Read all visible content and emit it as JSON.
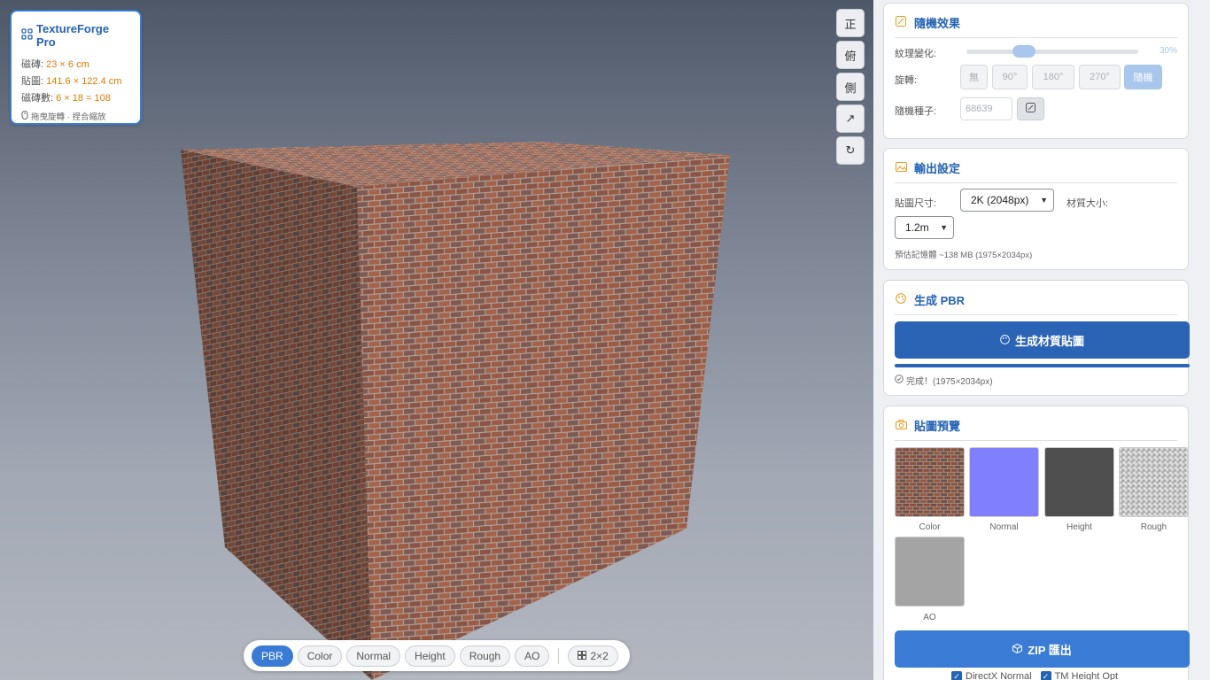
{
  "app": {
    "title": "TextureForge Pro",
    "tile_label": "磁磚: ",
    "tile_value": "23 × 6 cm",
    "map_label": "貼圖: ",
    "map_value": "141.6 × 122.4 cm",
    "count_label": "磁磚數: ",
    "count_value": "6 × 18 = 108",
    "hint": "拖曳旋轉 · 捏合縮放"
  },
  "camera_buttons": [
    {
      "label": "正"
    },
    {
      "label": "俯"
    },
    {
      "label": "側"
    },
    {
      "label": "↗"
    },
    {
      "label": "↻"
    }
  ],
  "bottom_bar": {
    "modes": [
      "PBR",
      "Color",
      "Normal",
      "Height",
      "Rough",
      "AO"
    ],
    "active_mode": "PBR",
    "tiling": "2×2"
  },
  "random_effects": {
    "title": "隨機效果",
    "variation_label": "紋理變化:",
    "variation_value": "30%",
    "variation_fraction": 0.3,
    "rotation_label": "旋轉:",
    "rotation_options": [
      "無",
      "90°",
      "180°",
      "270°",
      "隨機"
    ],
    "rotation_active": "隨機",
    "seed_label": "隨機種子:",
    "seed_value": "68639"
  },
  "output": {
    "title": "輸出設定",
    "map_size_label": "貼圖尺寸:",
    "map_size_value": "2K (2048px)",
    "material_size_label": "材質大小:",
    "material_size_value": "1.2m",
    "memory_estimate": "預估記憶體 ~138 MB (1975×2034px)"
  },
  "generate": {
    "title": "生成 PBR",
    "button_label": "生成材質貼圖",
    "progress_fraction": 1.0,
    "status": "完成！(1975×2034px)"
  },
  "preview": {
    "title": "貼圖預覽",
    "maps": [
      "Color",
      "Normal",
      "Height",
      "Rough",
      "AO"
    ],
    "export_label": "ZIP 匯出",
    "options": [
      "DirectX Normal",
      "TM Height Opt"
    ]
  },
  "colors": {
    "accent": "#3a7bd5",
    "primary_dark": "#2b63b5",
    "title_blue": "#2563b4",
    "highlight": "#d97a00",
    "normal_map": "#8080ff",
    "height_map": "#4f4f4f",
    "ao_map": "#a4a4a4"
  }
}
